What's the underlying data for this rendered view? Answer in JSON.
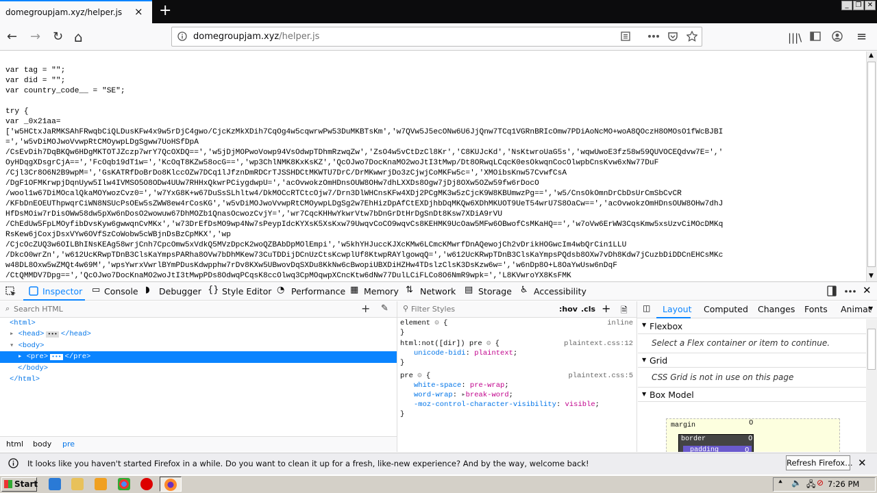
{
  "tab": {
    "title": "domegroupjam.xyz/helper.js",
    "close_icon": "×",
    "new_tab": "+"
  },
  "window_controls": {
    "minimize": "_",
    "restore": "❐",
    "close": "✕"
  },
  "nav": {
    "back_icon": "←",
    "forward_icon": "→",
    "reload_icon": "↻",
    "home_icon": "⌂",
    "url_host": "domegroupjam.xyz",
    "url_path": "/helper.js",
    "library_icon": "📚",
    "menu_icon": "≡"
  },
  "page": {
    "code_lines": [
      "var tag = \"\";",
      "var did = \"\";",
      "var country_code__ = \"SE\";",
      "",
      "try {",
      "var _0x21aa=",
      "['w5HCtxJaRMKSAhFRwqbCiQLDusKFw4x9w5rDjC4gwo/CjcKzMkXDih7CqOg4w5cqwrwPw53DuMKBTsKm','w7QVw5J5ecONw6U6JjQnw7TCq1VGRnBRIcOmw7PDiAoNcMO+woA8QOczH8OMOsO1fWcBJBI",
      "=','w5vDiMOJwoVvwpRtCMOywpLDgSgww7UoHSfDpA",
      "/CsEvDih7DqBKQw6HDgMKTOTJZczp7wrY7QcOXDQ==','w5jDjMOPwoVowp94VsOdwpTDhmRzwqZw','ZsO4w5vCtDzCl8Kr','C8KUJcKd','NsKtwroUaG5s','wqwUwoE3fz58w59QUVOCEQdvw7E=','",
      "OyHDqgXDsgrCjA==','FcOqb19dT1w=','KcOqT8KZw58ocG==','wp3ChlNMK8KxKsKZ','QcOJwo7DocKnaMO2woJtI3tMwp/Dt8ORwqLCqcK0esOkwqnCocOlwpbCnsKvw6xNw77DuF",
      "/Cjl3Cr8O6N2B9wpM=','GsKATRfDoBrDo8KlccOZw7DCq1lJfznDmRDCrTJSSHDCtMKWTU7DrC/DrMKwwrjDo3zCjwjCoMKFw5c=','XMOibsKnw57CvwfCsA",
      "/DgF1OFMKrwpjDqnUyw5Ilw4IVMSO5O8ODw4UUw7RHHxQkwrPCiygdwpU=','acOvwokzOmHDnsOUW8OHw7dhLXXDs8Ogw7jDj8OXw5OZw59fw6rDocO",
      "/wool1w67DiMOcalQkaMOYwozCvz0=','w7YxG8K+w67DuSsSLhltw4/DkMOCcRTCtcOjw7/Drn3DlWHCnsKFw4XDj2PCgMK3w5zCjcK9W8KBUmwzPg==','w5/CnsOkOmnDrCbDsUrCmSbCvCR",
      "/KFbDnEOEUThpwqrCiWN8NSUcPsOEw5sZWW8ew4rCosKG','w5vDiMOJwoVvwpRtCMOywpLDgSg2w7EhHizDpAfCtEXDjhbDqMKQw6XDhMKUOT9UeT54wrU7S8OaCw==','acOvwokzOmHDnsOUW8OHw7dhJ",
      "HfDsMOiw7rDisOWw58dw5pXw6nDosO2wowuw67DhMOZb1QnasOcwozCvjY=','wr7CqcKHHwYkwrVtw7bDnGrDtHrDgSnDt8Ksw7XDiA9rVU",
      "/ChEdUw5FpLMOyfibDvsKyw6gwwqnCvMKx','w73DrEfDsMO9wp4Nw7sPeypIdcKYXsK5XsKxw79UwqvCoCO9wqvCs8KEHMK9UcOaw5MFw6OBwofCsMKaHQ==','w7oVw6ErWW3CqsKmw5xsUzvCiMOcDMKq",
      "RsKew6jCoxjDsxVYw6OVfSzCoWobw5cWBjnDsBzCpMKX','wp",
      "/CjcOcZUQ3w6OILBhINsKEAg58wrjCnh7CpcOmw5xVdkQ5MVzDpcK2woQZBAbDpMOlEmpi','w5khYHJuccKJXcKMw6LCmcKMwrfDnAQewojCh2vDrikHOGwcIm4wbQrCin1LLU",
      "/DkcO0wrZn','w612UcKRwpTDnB3ClsKaYmpsPARha8OVw7bDhMKew73CuTDDijDCnUzCtsKcwplUf8KtwpRAYlgowqQ=','w612UcKRwpTDnB3ClsKaYmpsPQdsb8OXw7vDh8Kdw7jCuzbDiDDCnEHCsMKc",
      "w48DL8Oxw5wZMQt4w69M','wpsYwrxVwrlBYmPDusKdwpphw7rDv8KXw5UBwovDqSXDu8KkNw6cBwopiUBXDiHZHw4TDslzClsK3DsKzw6w=','w6nDp8O+L8OaYwUsw6nDqF",
      "/CtQMMDV7Dpg==','QcOJwo7DocKnaMO2woJtI3tMwpPDs8OdwqPCqsK8ccOlwq3CpMOqwpXCncKtw6dNw77DulLCiFLCo8O6NmR9wpk=','L8KVwroYX8KsFMK"
    ]
  },
  "devtools": {
    "tabs": [
      "Inspector",
      "Console",
      "Debugger",
      "Style Editor",
      "Performance",
      "Memory",
      "Network",
      "Storage",
      "Accessibility"
    ],
    "search_html_placeholder": "Search HTML",
    "markup": {
      "html_open": "<html>",
      "head": "<head>",
      "head_close": "</head>",
      "body_open": "<body>",
      "pre_open": "<pre>",
      "pre_close": "</pre>",
      "body_close": "</body>",
      "html_close": "</html>",
      "ellipsis": "•••"
    },
    "breadcrumbs": [
      "html",
      "body",
      "pre"
    ],
    "filter_styles_placeholder": "Filter Styles",
    "hov": ":hov",
    "cls": ".cls",
    "rules": [
      {
        "selector": "element",
        "source": "inline",
        "props": []
      },
      {
        "selector": "html:not([dir]) pre",
        "source": "plaintext.css:12",
        "props": [
          {
            "name": "unicode-bidi",
            "value": "plaintext"
          }
        ]
      },
      {
        "selector": "pre",
        "source": "plaintext.css:5",
        "props": [
          {
            "name": "white-space",
            "value": "pre-wrap"
          },
          {
            "name": "word-wrap",
            "value": "break-word"
          },
          {
            "name": "-moz-control-character-visibility",
            "value": "visible"
          }
        ]
      }
    ],
    "side_tabs": [
      "Layout",
      "Computed",
      "Changes",
      "Fonts",
      "Animat"
    ],
    "layout": {
      "flexbox_title": "Flexbox",
      "flexbox_note": "Select a Flex container or item to continue.",
      "grid_title": "Grid",
      "grid_note": "CSS Grid is not in use on this page",
      "boxmodel_title": "Box Model",
      "margin_label": "margin",
      "border_label": "border",
      "padding_label": "padding",
      "zero": "0"
    }
  },
  "notification": {
    "text": "It looks like you haven't started Firefox in a while. Do you want to clean it up for a fresh, like-new experience? And by the way, welcome back!",
    "button": "Refresh Firefox…"
  },
  "taskbar": {
    "start": "Start",
    "clock": "7:26 PM"
  },
  "colors": {
    "accent": "#0a84ff",
    "selected_row": "#0a84ff",
    "tag": "#0074e8",
    "value": "#c0008b"
  }
}
